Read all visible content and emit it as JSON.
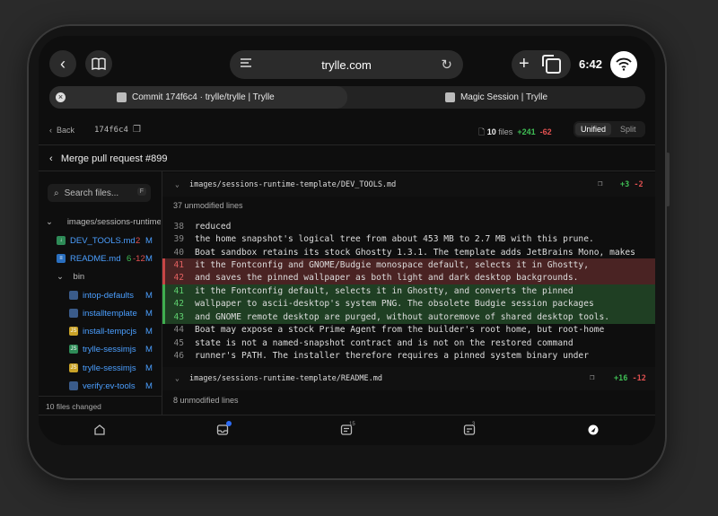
{
  "browser": {
    "url": "trylle.com",
    "time": "6:42",
    "tabs": [
      {
        "title": "Commit 174f6c4 · trylle/trylle | Trylle",
        "active": true
      },
      {
        "title": "Magic Session | Trylle",
        "active": false
      }
    ]
  },
  "toolbar": {
    "back_label": "Back",
    "commit_hash": "174f6c4",
    "files_count": "10",
    "files_label": "files",
    "additions": "+241",
    "deletions": "-62",
    "view_unified": "Unified",
    "view_split": "Split"
  },
  "pr_title": "Merge pull request #899",
  "sidebar": {
    "search_placeholder": "Search files...",
    "search_kbd": "F",
    "folder": "images/sessions-runtime-template",
    "files": [
      {
        "name": "DEV_TOOLS.md",
        "add": "2",
        "status": "M"
      },
      {
        "name": "README.md",
        "add": "6",
        "del": "-12",
        "status": "M"
      }
    ],
    "subfolder": "bin",
    "bin_files": [
      {
        "name": "intop-defaults",
        "status": "M"
      },
      {
        "name": "installtemplate",
        "status": "M"
      },
      {
        "name": "install-tempcjs",
        "status": "M"
      },
      {
        "name": "trylle-sessimjs",
        "status": "M"
      },
      {
        "name": "trylle-sessimjs",
        "status": "M"
      },
      {
        "name": "verify:ev-tools",
        "status": "M"
      }
    ],
    "summary": "10 files changed"
  },
  "diff": {
    "file1": {
      "path": "images/sessions-runtime-template/DEV_TOOLS.md",
      "add": "+3",
      "del": "-2",
      "unmodified": "37 unmodified lines",
      "lines": [
        {
          "n": "38",
          "t": "reduced",
          "k": "ctx"
        },
        {
          "n": "39",
          "t": "the home snapshot's logical tree from about 453 MB to 2.7 MB with this prune.",
          "k": "ctx"
        },
        {
          "n": "40",
          "t": "Boat sandbox retains its stock Ghostty 1.3.1. The template adds JetBrains Mono, makes",
          "k": "ctx"
        },
        {
          "n": "41",
          "t": "it the Fontconfig and GNOME/Budgie monospace default, selects it in Ghostty,",
          "k": "del"
        },
        {
          "n": "42",
          "t": "and saves the pinned wallpaper as both light and dark desktop backgrounds.",
          "k": "del"
        },
        {
          "n": "41",
          "t": "it the Fontconfig default, selects it in Ghostty, and converts the pinned",
          "k": "add"
        },
        {
          "n": "42",
          "t": "wallpaper to ascii-desktop's system PNG. The obsolete Budgie session packages",
          "k": "add"
        },
        {
          "n": "43",
          "t": "and GNOME remote desktop are purged, without autoremove of shared desktop tools.",
          "k": "add"
        },
        {
          "n": "44",
          "t": "Boat may expose a stock Prime Agent from the builder's root home, but root-home",
          "k": "ctx"
        },
        {
          "n": "45",
          "t": "state is not a named-snapshot contract and is not on the restored command",
          "k": "ctx"
        },
        {
          "n": "46",
          "t": "runner's PATH. The installer therefore requires a pinned system binary under",
          "k": "ctx"
        }
      ]
    },
    "file2": {
      "path": "images/sessions-runtime-template/README.md",
      "add": "+16",
      "del": "-12",
      "unmodified": "8 unmodified lines"
    }
  },
  "bottom_nav": {
    "badge_15": "15",
    "badge_3": "3"
  }
}
